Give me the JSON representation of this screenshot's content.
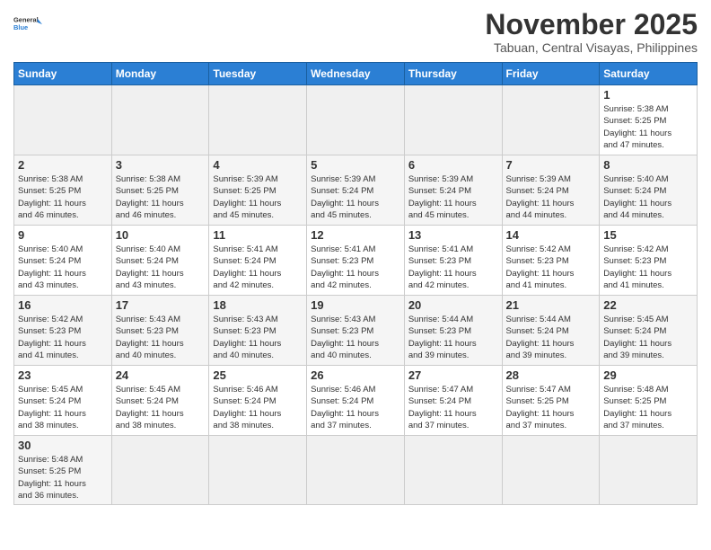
{
  "header": {
    "logo_general": "General",
    "logo_blue": "Blue",
    "month_title": "November 2025",
    "location": "Tabuan, Central Visayas, Philippines"
  },
  "days_of_week": [
    "Sunday",
    "Monday",
    "Tuesday",
    "Wednesday",
    "Thursday",
    "Friday",
    "Saturday"
  ],
  "weeks": [
    [
      {
        "day": "",
        "info": ""
      },
      {
        "day": "",
        "info": ""
      },
      {
        "day": "",
        "info": ""
      },
      {
        "day": "",
        "info": ""
      },
      {
        "day": "",
        "info": ""
      },
      {
        "day": "",
        "info": ""
      },
      {
        "day": "1",
        "info": "Sunrise: 5:38 AM\nSunset: 5:25 PM\nDaylight: 11 hours\nand 47 minutes."
      }
    ],
    [
      {
        "day": "2",
        "info": "Sunrise: 5:38 AM\nSunset: 5:25 PM\nDaylight: 11 hours\nand 46 minutes."
      },
      {
        "day": "3",
        "info": "Sunrise: 5:38 AM\nSunset: 5:25 PM\nDaylight: 11 hours\nand 46 minutes."
      },
      {
        "day": "4",
        "info": "Sunrise: 5:39 AM\nSunset: 5:25 PM\nDaylight: 11 hours\nand 45 minutes."
      },
      {
        "day": "5",
        "info": "Sunrise: 5:39 AM\nSunset: 5:24 PM\nDaylight: 11 hours\nand 45 minutes."
      },
      {
        "day": "6",
        "info": "Sunrise: 5:39 AM\nSunset: 5:24 PM\nDaylight: 11 hours\nand 45 minutes."
      },
      {
        "day": "7",
        "info": "Sunrise: 5:39 AM\nSunset: 5:24 PM\nDaylight: 11 hours\nand 44 minutes."
      },
      {
        "day": "8",
        "info": "Sunrise: 5:40 AM\nSunset: 5:24 PM\nDaylight: 11 hours\nand 44 minutes."
      }
    ],
    [
      {
        "day": "9",
        "info": "Sunrise: 5:40 AM\nSunset: 5:24 PM\nDaylight: 11 hours\nand 43 minutes."
      },
      {
        "day": "10",
        "info": "Sunrise: 5:40 AM\nSunset: 5:24 PM\nDaylight: 11 hours\nand 43 minutes."
      },
      {
        "day": "11",
        "info": "Sunrise: 5:41 AM\nSunset: 5:24 PM\nDaylight: 11 hours\nand 42 minutes."
      },
      {
        "day": "12",
        "info": "Sunrise: 5:41 AM\nSunset: 5:23 PM\nDaylight: 11 hours\nand 42 minutes."
      },
      {
        "day": "13",
        "info": "Sunrise: 5:41 AM\nSunset: 5:23 PM\nDaylight: 11 hours\nand 42 minutes."
      },
      {
        "day": "14",
        "info": "Sunrise: 5:42 AM\nSunset: 5:23 PM\nDaylight: 11 hours\nand 41 minutes."
      },
      {
        "day": "15",
        "info": "Sunrise: 5:42 AM\nSunset: 5:23 PM\nDaylight: 11 hours\nand 41 minutes."
      }
    ],
    [
      {
        "day": "16",
        "info": "Sunrise: 5:42 AM\nSunset: 5:23 PM\nDaylight: 11 hours\nand 41 minutes."
      },
      {
        "day": "17",
        "info": "Sunrise: 5:43 AM\nSunset: 5:23 PM\nDaylight: 11 hours\nand 40 minutes."
      },
      {
        "day": "18",
        "info": "Sunrise: 5:43 AM\nSunset: 5:23 PM\nDaylight: 11 hours\nand 40 minutes."
      },
      {
        "day": "19",
        "info": "Sunrise: 5:43 AM\nSunset: 5:23 PM\nDaylight: 11 hours\nand 40 minutes."
      },
      {
        "day": "20",
        "info": "Sunrise: 5:44 AM\nSunset: 5:23 PM\nDaylight: 11 hours\nand 39 minutes."
      },
      {
        "day": "21",
        "info": "Sunrise: 5:44 AM\nSunset: 5:24 PM\nDaylight: 11 hours\nand 39 minutes."
      },
      {
        "day": "22",
        "info": "Sunrise: 5:45 AM\nSunset: 5:24 PM\nDaylight: 11 hours\nand 39 minutes."
      }
    ],
    [
      {
        "day": "23",
        "info": "Sunrise: 5:45 AM\nSunset: 5:24 PM\nDaylight: 11 hours\nand 38 minutes."
      },
      {
        "day": "24",
        "info": "Sunrise: 5:45 AM\nSunset: 5:24 PM\nDaylight: 11 hours\nand 38 minutes."
      },
      {
        "day": "25",
        "info": "Sunrise: 5:46 AM\nSunset: 5:24 PM\nDaylight: 11 hours\nand 38 minutes."
      },
      {
        "day": "26",
        "info": "Sunrise: 5:46 AM\nSunset: 5:24 PM\nDaylight: 11 hours\nand 37 minutes."
      },
      {
        "day": "27",
        "info": "Sunrise: 5:47 AM\nSunset: 5:24 PM\nDaylight: 11 hours\nand 37 minutes."
      },
      {
        "day": "28",
        "info": "Sunrise: 5:47 AM\nSunset: 5:25 PM\nDaylight: 11 hours\nand 37 minutes."
      },
      {
        "day": "29",
        "info": "Sunrise: 5:48 AM\nSunset: 5:25 PM\nDaylight: 11 hours\nand 37 minutes."
      }
    ],
    [
      {
        "day": "30",
        "info": "Sunrise: 5:48 AM\nSunset: 5:25 PM\nDaylight: 11 hours\nand 36 minutes."
      },
      {
        "day": "",
        "info": ""
      },
      {
        "day": "",
        "info": ""
      },
      {
        "day": "",
        "info": ""
      },
      {
        "day": "",
        "info": ""
      },
      {
        "day": "",
        "info": ""
      },
      {
        "day": "",
        "info": ""
      }
    ]
  ]
}
